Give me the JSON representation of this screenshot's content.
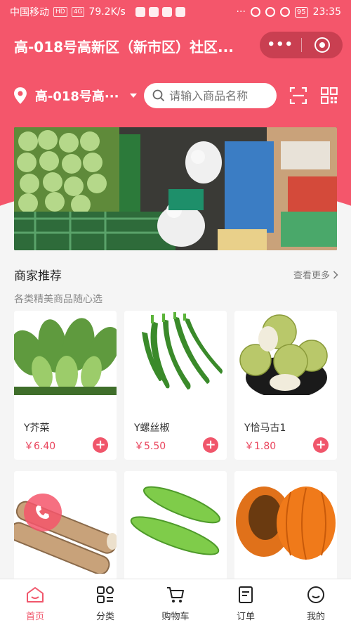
{
  "status_bar": {
    "carrier": "中国移动",
    "hd": "HD",
    "network": "4G",
    "speed": "79.2K/s",
    "battery": "95",
    "time": "23:35"
  },
  "nav": {
    "title": "高-018号高新区（新市区）社区...",
    "more_label": "•••"
  },
  "search": {
    "location": "高-018号高···",
    "placeholder": "请输入商品名称"
  },
  "section": {
    "title": "商家推荐",
    "more": "查看更多",
    "subtitle": "各类精美商品随心选"
  },
  "products": [
    {
      "name": "Y芥菜",
      "price": "￥6.40"
    },
    {
      "name": "Y螺丝椒",
      "price": "￥5.50"
    },
    {
      "name": "Y恰马古1",
      "price": "￥1.80"
    }
  ],
  "tabs": [
    {
      "label": "首页",
      "icon": "home-icon",
      "active": true
    },
    {
      "label": "分类",
      "icon": "category-icon",
      "active": false
    },
    {
      "label": "购物车",
      "icon": "cart-icon",
      "active": false
    },
    {
      "label": "订单",
      "icon": "order-icon",
      "active": false
    },
    {
      "label": "我的",
      "icon": "profile-icon",
      "active": false
    }
  ],
  "colors": {
    "brand": "#f4566b",
    "price": "#e9445c"
  }
}
